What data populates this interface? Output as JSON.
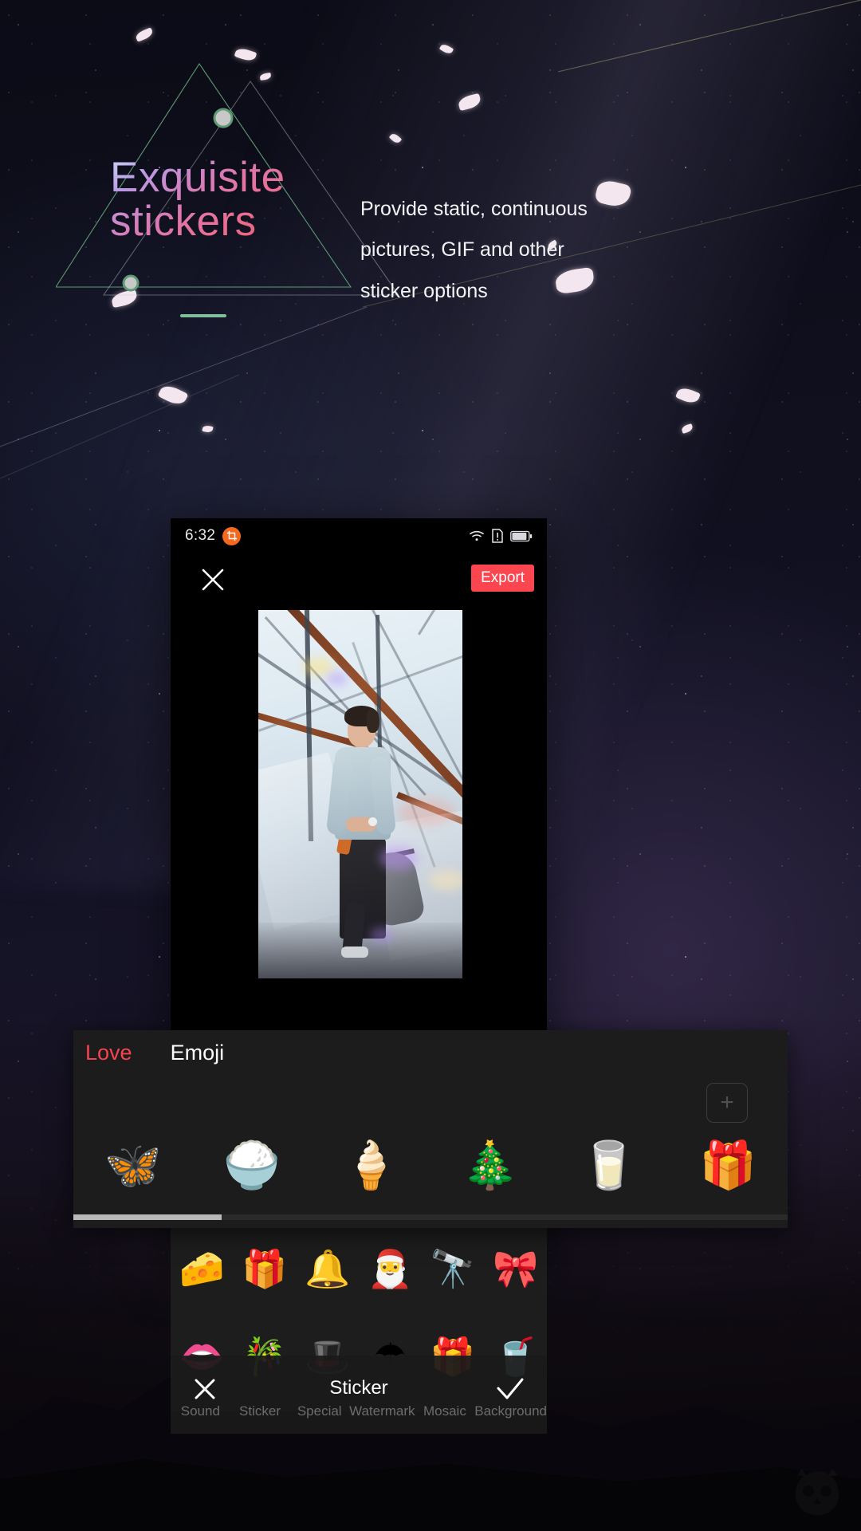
{
  "promo": {
    "headline": "Exquisite stickers",
    "subcopy": "Provide static, continuous pictures, GIF and other sticker options",
    "accent_green": "#7fbf9a",
    "gradient_from": "#c9d6f6",
    "gradient_to": "#ef7560"
  },
  "phone": {
    "statusbar": {
      "time": "6:32",
      "app_icon": "crop-icon",
      "icons": [
        "wifi-icon",
        "sim-card-alert-icon",
        "battery-icon"
      ]
    },
    "topbar": {
      "close_icon": "close-icon",
      "export_label": "Export",
      "export_color": "#fb4650"
    },
    "canvas": {
      "media_name": "photo-preview"
    }
  },
  "sticker_panel": {
    "tabs": [
      {
        "label": "Love",
        "active": true
      },
      {
        "label": "Emoji",
        "active": false
      }
    ],
    "active_tab_color": "#f6434f",
    "add_label": "+",
    "stickers": [
      {
        "name": "butterfly",
        "glyph": "🦋"
      },
      {
        "name": "rice-bowl",
        "glyph": "🍚"
      },
      {
        "name": "ice-cream-cone",
        "glyph": "🍦"
      },
      {
        "name": "christmas-wreath",
        "glyph": "🎄"
      },
      {
        "name": "milk-carton",
        "glyph": "🥛"
      },
      {
        "name": "wrapped-gift-purple",
        "glyph": "🎁"
      }
    ]
  },
  "sticker_grid": {
    "row1": [
      {
        "name": "cheese-wedge",
        "glyph": "🧀"
      },
      {
        "name": "gift-teal-bow",
        "glyph": "🎁"
      },
      {
        "name": "jingle-bell",
        "glyph": "🔔"
      },
      {
        "name": "santa-claus",
        "glyph": "🎅"
      },
      {
        "name": "binoculars",
        "glyph": "🔭"
      },
      {
        "name": "gift-pink-bow",
        "glyph": "🎀"
      }
    ],
    "row2": [
      {
        "name": "lips-dark-pink",
        "glyph": "👄"
      },
      {
        "name": "gold-bow-ribbon",
        "glyph": "🎋"
      },
      {
        "name": "santa-hat-half",
        "glyph": "🎩"
      },
      {
        "name": "red-umbrella",
        "glyph": "☂"
      },
      {
        "name": "gold-gift-bow",
        "glyph": "🎁"
      },
      {
        "name": "cocktail-drink",
        "glyph": "🥤"
      }
    ]
  },
  "toolbar": {
    "title": "Sticker",
    "cancel_icon": "close-icon",
    "confirm_icon": "check-icon",
    "items": [
      {
        "label": "Sound",
        "icon": "music-note-icon"
      },
      {
        "label": "Sticker",
        "icon": "sticker-icon"
      },
      {
        "label": "Special",
        "icon": "sparkle-icon"
      },
      {
        "label": "Watermark",
        "icon": "droplet-icon"
      },
      {
        "label": "Mosaic",
        "icon": "mosaic-grid-icon"
      },
      {
        "label": "Background",
        "icon": "background-icon"
      }
    ]
  },
  "watermark": {
    "name": "owl-logo"
  }
}
